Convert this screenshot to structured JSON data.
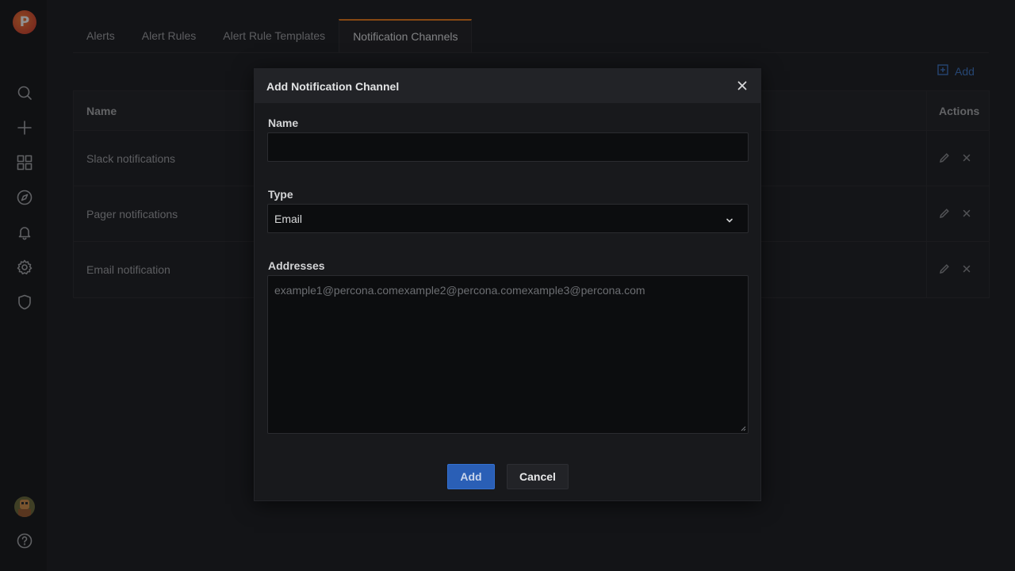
{
  "sidebar": {
    "logo_letter": "P",
    "icons": [
      "search-icon",
      "plus-icon",
      "dashboards-icon",
      "explore-icon",
      "alert-bell-icon",
      "gear-icon",
      "shield-icon",
      "avatar",
      "help-icon"
    ]
  },
  "tabs": [
    {
      "label": "Alerts"
    },
    {
      "label": "Alert Rules"
    },
    {
      "label": "Alert Rule Templates"
    },
    {
      "label": "Notification Channels",
      "active": true
    }
  ],
  "toolbar": {
    "add_label": "Add"
  },
  "table": {
    "headers": {
      "name": "Name",
      "actions": "Actions"
    },
    "rows": [
      {
        "name": "Slack notifications"
      },
      {
        "name": "Pager notifications"
      },
      {
        "name": "Email notification"
      }
    ]
  },
  "modal": {
    "title": "Add Notification Channel",
    "name_label": "Name",
    "name_value": "",
    "type_label": "Type",
    "type_value": "Email",
    "addresses_label": "Addresses",
    "addresses_placeholder": "example1@percona.comexample2@percona.comexample3@percona.com",
    "add_button": "Add",
    "cancel_button": "Cancel"
  },
  "colors": {
    "accent_tab": "#eb7b18",
    "primary_button": "#2a5fb6",
    "link": "#3c77c7"
  }
}
